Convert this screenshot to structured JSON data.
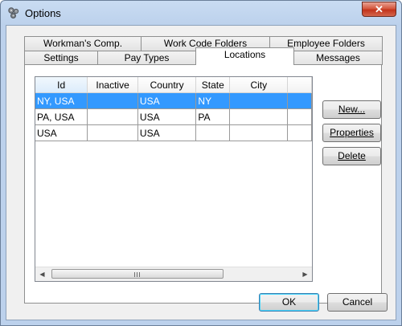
{
  "window": {
    "title": "Options",
    "close_glyph": "✕",
    "app_icon": "options-gears-icon"
  },
  "tabs_back": [
    "Workman's Comp.",
    "Work Code Folders",
    "Employee Folders"
  ],
  "tabs_front": [
    "Settings",
    "Pay Types",
    "Locations",
    "Messages"
  ],
  "active_tab": "Locations",
  "grid": {
    "columns": [
      "Id",
      "Inactive",
      "Country",
      "State",
      "City",
      ""
    ],
    "sorted_column": "Id",
    "rows": [
      [
        "NY, USA",
        "",
        "USA",
        "NY",
        "",
        ""
      ],
      [
        "PA, USA",
        "",
        "USA",
        "PA",
        "",
        ""
      ],
      [
        "USA",
        "",
        "USA",
        "",
        "",
        ""
      ]
    ],
    "selected_row": 0
  },
  "side_buttons": {
    "new": "New...",
    "properties": "Properties",
    "delete": "Delete"
  },
  "footer": {
    "ok": "OK",
    "cancel": "Cancel"
  },
  "colors": {
    "selection": "#3399ff",
    "title_gradient": "#c9dcf2",
    "close_button": "#c2331b"
  }
}
